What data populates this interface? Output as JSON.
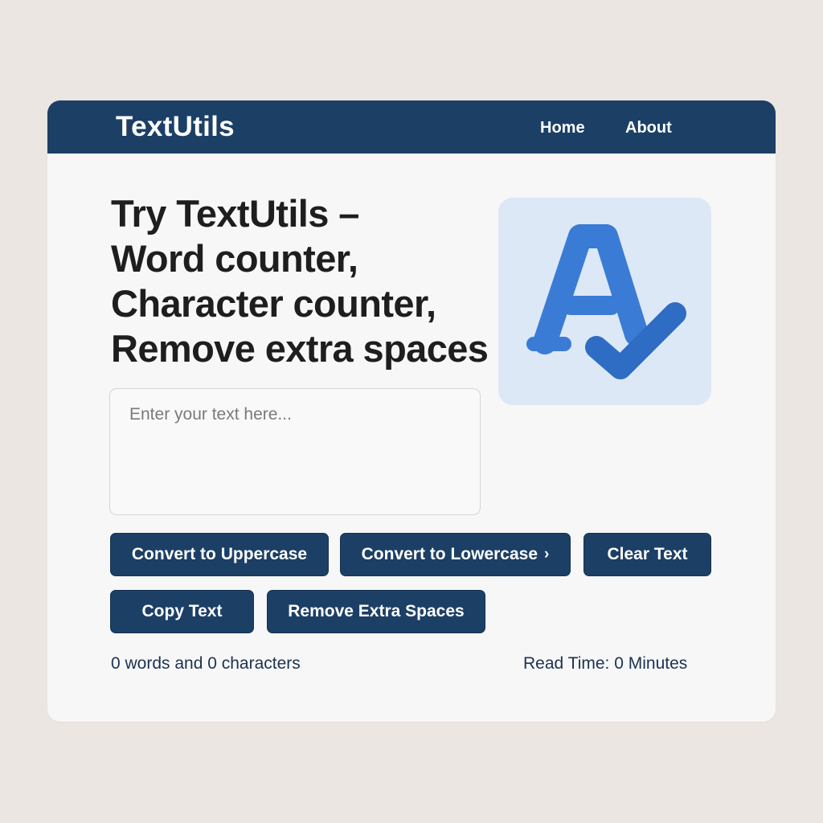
{
  "navbar": {
    "brand": "TextUtils",
    "links": [
      "Home",
      "About"
    ]
  },
  "hero": {
    "heading_lines": [
      "Try TextUtils –",
      "Word counter,",
      "Character counter,",
      "Remove extra spaces"
    ],
    "logo_icon": "spellcheck-a-icon"
  },
  "editor": {
    "placeholder": "Enter your text here...",
    "value": ""
  },
  "buttons": {
    "uppercase": "Convert to Uppercase",
    "lowercase": "Convert to Lowercase",
    "clear": "Clear Text",
    "copy": "Copy Text",
    "remove_spaces": "Remove Extra Spaces"
  },
  "summary": {
    "counts": "0 words and 0 characters",
    "read_time": "Read Time: 0 Minutes"
  },
  "colors": {
    "navbar": "#1c3f66",
    "button": "#1c3f66",
    "page_background": "#ebe6e1",
    "logo_tile": "#dce8f5",
    "logo_mark": "#3a7bd5"
  }
}
